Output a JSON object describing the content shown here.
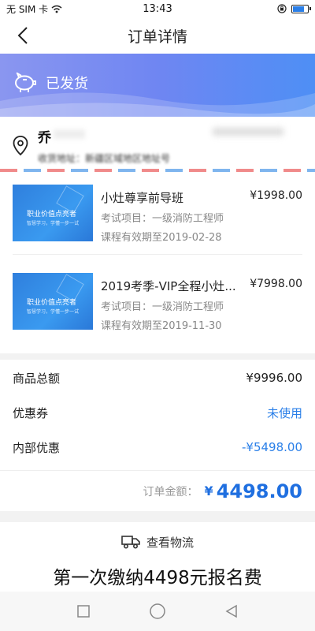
{
  "status_bar": {
    "carrier": "无 SIM 卡",
    "time": "13:43"
  },
  "nav": {
    "title": "订单详情"
  },
  "order_status": {
    "label": "已发货"
  },
  "address": {
    "name": "乔",
    "line": "收货地址：新疆区域地区地址号"
  },
  "items": [
    {
      "thumb_title": "职业价值点亮者",
      "thumb_sub": "智慧学习，学懂一步一试",
      "name": "小灶尊享前导班",
      "price": "¥1998.00",
      "exam": "考试项目：一级消防工程师",
      "validity": "课程有效期至2019-02-28"
    },
    {
      "thumb_title": "职业价值点亮者",
      "thumb_sub": "智慧学习，学懂一步一试",
      "name": "2019考季-VIP全程小灶...",
      "price": "¥7998.00",
      "exam": "考试项目：一级消防工程师",
      "validity": "课程有效期至2019-11-30"
    }
  ],
  "summary": {
    "rows": [
      {
        "label": "商品总额",
        "value": "¥9996.00"
      },
      {
        "label": "优惠券",
        "value": "未使用"
      },
      {
        "label": "内部优惠",
        "value": "-¥5498.00"
      }
    ],
    "total_label": "订单金额：",
    "currency": "¥",
    "total_value": "4498.00"
  },
  "logistics": {
    "label": "查看物流"
  },
  "caption": "第一次缴纳4498元报名费",
  "colors": {
    "accent": "#2a7fe8",
    "banner_start": "#8a96f0",
    "banner_end": "#4e8ff5"
  }
}
